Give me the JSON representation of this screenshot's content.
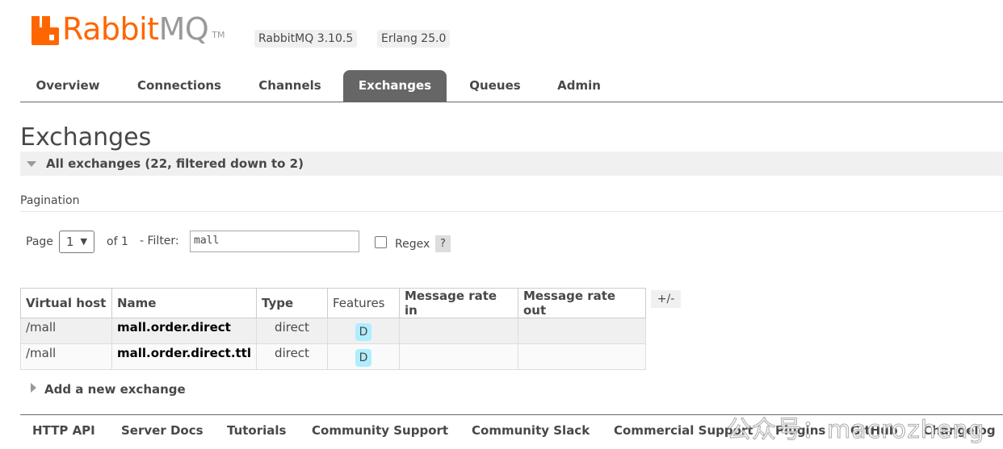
{
  "header": {
    "logo_text_rabbit": "Rabbit",
    "logo_text_mq": "MQ",
    "logo_tm": "TM",
    "rabbitmq_version": "RabbitMQ 3.10.5",
    "erlang_version": "Erlang 25.0",
    "brand_color": "#ff6600"
  },
  "tabs": [
    "Overview",
    "Connections",
    "Channels",
    "Exchanges",
    "Queues",
    "Admin"
  ],
  "active_tab": "Exchanges",
  "page": {
    "title": "Exchanges",
    "section_label": "All exchanges (22, filtered down to 2)",
    "pagination_label": "Pagination",
    "page_label": "Page",
    "page_value": "1",
    "of_label": "of 1",
    "filter_label": "- Filter:",
    "filter_value": "mall",
    "regex_label": "Regex",
    "help_label": "?"
  },
  "table": {
    "columns": [
      "Virtual host",
      "Name",
      "Type",
      "Features",
      "Message rate in",
      "Message rate out"
    ],
    "plus_minus": "+/-",
    "rows": [
      {
        "vhost": "/mall",
        "name": "mall.order.direct",
        "type": "direct",
        "features": "D",
        "rate_in": "",
        "rate_out": ""
      },
      {
        "vhost": "/mall",
        "name": "mall.order.direct.ttl",
        "type": "direct",
        "features": "D",
        "rate_in": "",
        "rate_out": ""
      }
    ]
  },
  "add_new_label": "Add a new exchange",
  "footer": [
    "HTTP API",
    "Server Docs",
    "Tutorials",
    "Community Support",
    "Community Slack",
    "Commercial Support",
    "Plugins",
    "GitHub",
    "Changelog"
  ],
  "watermark": "公众号：macrozheng"
}
